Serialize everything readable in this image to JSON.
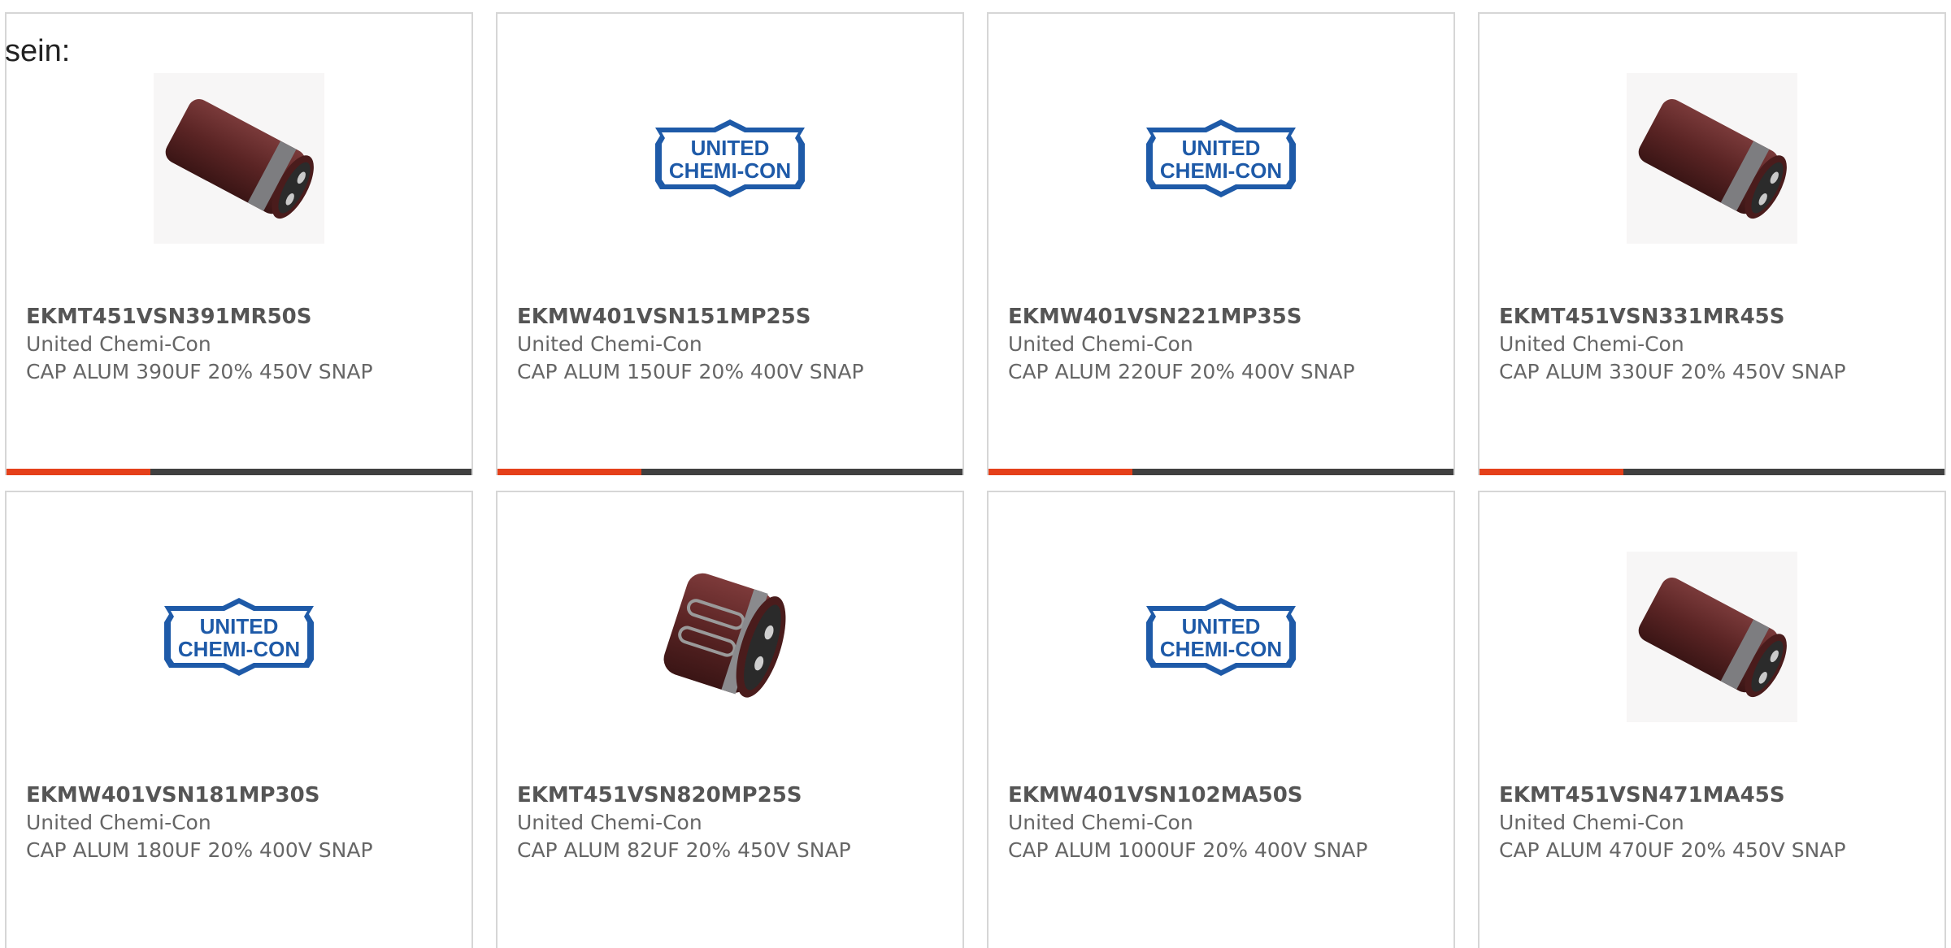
{
  "heading": "sein:",
  "colors": {
    "accent": "#e5401a",
    "bar_track": "#404040",
    "logo_blue": "#1e5aa8",
    "cap_brown": "#5a2424"
  },
  "cards": [
    {
      "part": "EKMT451VSN391MR50S",
      "manufacturer": "United Chemi-Con",
      "description": "CAP ALUM 390UF 20% 450V SNAP",
      "image": "capacitor-long-icon",
      "progress": 0.31
    },
    {
      "part": "EKMW401VSN151MP25S",
      "manufacturer": "United Chemi-Con",
      "description": "CAP ALUM 150UF 20% 400V SNAP",
      "image": "united-chemi-con-logo",
      "logo_text": [
        "UNITED",
        "CHEMI-CON"
      ],
      "progress": 0.31
    },
    {
      "part": "EKMW401VSN221MP35S",
      "manufacturer": "United Chemi-Con",
      "description": "CAP ALUM 220UF 20% 400V SNAP",
      "image": "united-chemi-con-logo",
      "logo_text": [
        "UNITED",
        "CHEMI-CON"
      ],
      "progress": 0.31
    },
    {
      "part": "EKMT451VSN331MR45S",
      "manufacturer": "United Chemi-Con",
      "description": "CAP ALUM 330UF 20% 450V SNAP",
      "image": "capacitor-long-icon",
      "progress": 0.31
    },
    {
      "part": "EKMW401VSN181MP30S",
      "manufacturer": "United Chemi-Con",
      "description": "CAP ALUM 180UF 20% 400V SNAP",
      "image": "united-chemi-con-logo",
      "logo_text": [
        "UNITED",
        "CHEMI-CON"
      ]
    },
    {
      "part": "EKMT451VSN820MP25S",
      "manufacturer": "United Chemi-Con",
      "description": "CAP ALUM 82UF 20% 450V SNAP",
      "image": "capacitor-short-icon"
    },
    {
      "part": "EKMW401VSN102MA50S",
      "manufacturer": "United Chemi-Con",
      "description": "CAP ALUM 1000UF 20% 400V SNAP",
      "image": "united-chemi-con-logo",
      "logo_text": [
        "UNITED",
        "CHEMI-CON"
      ]
    },
    {
      "part": "EKMT451VSN471MA45S",
      "manufacturer": "United Chemi-Con",
      "description": "CAP ALUM 470UF 20% 450V SNAP",
      "image": "capacitor-long-icon"
    }
  ]
}
